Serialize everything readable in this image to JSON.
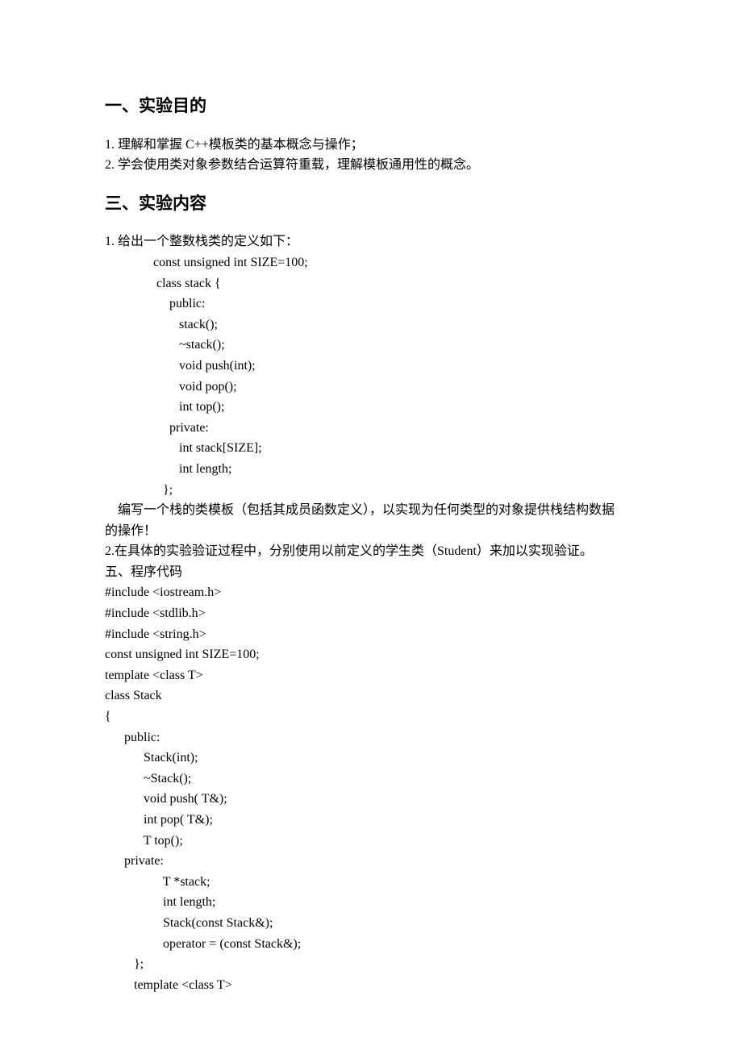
{
  "heading1": "一、实验目的",
  "objectives": [
    "1.    理解和掌握 C++模板类的基本概念与操作；",
    "2.    学会使用类对象参数结合运算符重载，理解模板通用性的概念。"
  ],
  "heading2": "三、实验内容",
  "content_lines": [
    "1. 给出一个整数栈类的定义如下：",
    "               const unsigned int SIZE=100;",
    "                class stack {",
    "                    public:",
    "                       stack();",
    "                       ~stack();",
    "                       void push(int);",
    "                       void pop();",
    "                       int top();",
    "                    private:",
    "                       int stack[SIZE];",
    "                       int length;",
    "                  };",
    "    编写一个栈的类模板（包括其成员函数定义），以实现为任何类型的对象提供栈结构数据",
    "的操作！",
    "2.在具体的实验验证过程中，分别使用以前定义的学生类（Student）来加以实现验证。",
    "五、程序代码",
    "#include <iostream.h>",
    "#include <stdlib.h>",
    "#include <string.h>",
    "const unsigned int SIZE=100;",
    "template <class T>",
    "class Stack",
    "{",
    "      public:",
    "            Stack(int);",
    "            ~Stack();",
    "            void push( T&);",
    "            int pop( T&);",
    "            T top();",
    "      private:",
    "                  T *stack;",
    "                  int length;",
    "                  Stack(const Stack&);",
    "                  operator = (const Stack&);",
    "         };",
    "         template <class T>"
  ]
}
